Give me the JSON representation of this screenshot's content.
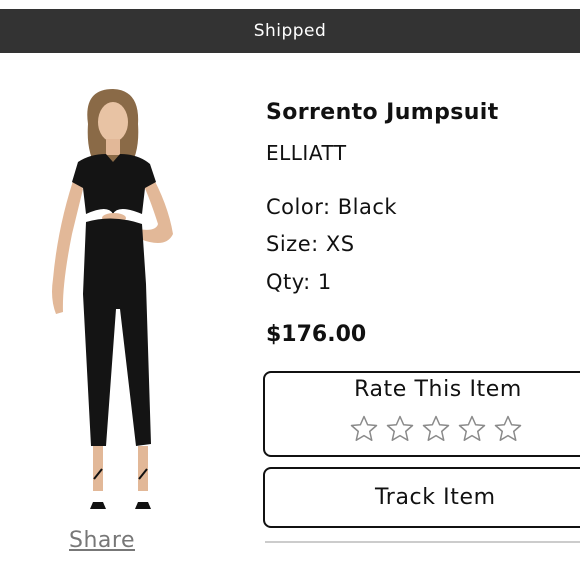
{
  "status_bar": {
    "label": "Shipped"
  },
  "product": {
    "title": "Sorrento Jumpsuit",
    "brand": "ELLIATT",
    "color": "Color: Black",
    "size": "Size: XS",
    "qty": "Qty: 1",
    "price": "$176.00"
  },
  "rating": {
    "title": "Rate This Item",
    "stars_total": 5,
    "stars_filled": 0
  },
  "actions": {
    "track_label": "Track Item",
    "share_label": "Share"
  },
  "colors": {
    "status_bar_bg": "#333333",
    "text": "#111111",
    "share": "#777777"
  }
}
